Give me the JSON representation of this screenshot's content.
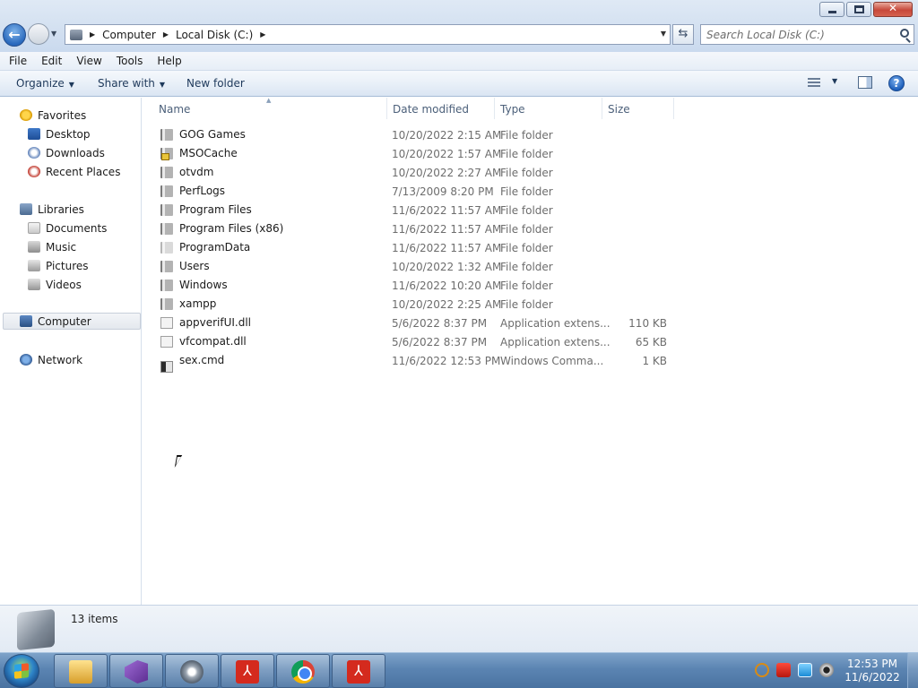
{
  "window": {
    "minimize_label": "",
    "maximize_label": "",
    "close_label": "✕"
  },
  "address_bar": {
    "crumbs": [
      "Computer",
      "Local Disk (C:)"
    ],
    "search_placeholder": "Search Local Disk (C:)"
  },
  "menu": [
    "File",
    "Edit",
    "View",
    "Tools",
    "Help"
  ],
  "toolbar": {
    "organize": "Organize",
    "share_with": "Share with",
    "new_folder": "New folder"
  },
  "nav_pane": {
    "favorites": {
      "label": "Favorites",
      "items": [
        "Desktop",
        "Downloads",
        "Recent Places"
      ]
    },
    "libraries": {
      "label": "Libraries",
      "items": [
        "Documents",
        "Music",
        "Pictures",
        "Videos"
      ]
    },
    "computer": "Computer",
    "network": "Network"
  },
  "columns": [
    "Name",
    "Date modified",
    "Type",
    "Size"
  ],
  "files": [
    {
      "name": "GOG Games",
      "date": "10/20/2022 2:15 AM",
      "type": "File folder",
      "size": "",
      "icon": "folder-icon"
    },
    {
      "name": "MSOCache",
      "date": "10/20/2022 1:57 AM",
      "type": "File folder",
      "size": "",
      "icon": "locked-folder-icon"
    },
    {
      "name": "otvdm",
      "date": "10/20/2022 2:27 AM",
      "type": "File folder",
      "size": "",
      "icon": "folder-icon"
    },
    {
      "name": "PerfLogs",
      "date": "7/13/2009 8:20 PM",
      "type": "File folder",
      "size": "",
      "icon": "folder-icon"
    },
    {
      "name": "Program Files",
      "date": "11/6/2022 11:57 AM",
      "type": "File folder",
      "size": "",
      "icon": "folder-icon"
    },
    {
      "name": "Program Files (x86)",
      "date": "11/6/2022 11:57 AM",
      "type": "File folder",
      "size": "",
      "icon": "folder-icon"
    },
    {
      "name": "ProgramData",
      "date": "11/6/2022 11:57 AM",
      "type": "File folder",
      "size": "",
      "icon": "hidden-folder-icon"
    },
    {
      "name": "Users",
      "date": "10/20/2022 1:32 AM",
      "type": "File folder",
      "size": "",
      "icon": "folder-icon"
    },
    {
      "name": "Windows",
      "date": "11/6/2022 10:20 AM",
      "type": "File folder",
      "size": "",
      "icon": "folder-icon"
    },
    {
      "name": "xampp",
      "date": "10/20/2022 2:25 AM",
      "type": "File folder",
      "size": "",
      "icon": "folder-icon"
    },
    {
      "name": "appverifUI.dll",
      "date": "5/6/2022 8:37 PM",
      "type": "Application extens...",
      "size": "110 KB",
      "icon": "dll-file-icon"
    },
    {
      "name": "vfcompat.dll",
      "date": "5/6/2022 8:37 PM",
      "type": "Application extens...",
      "size": "65 KB",
      "icon": "dll-file-icon"
    },
    {
      "name": "sex.cmd",
      "date": "11/6/2022 12:53 PM",
      "type": "Windows Comma...",
      "size": "1 KB",
      "icon": "cmd-file-icon"
    }
  ],
  "status": {
    "item_count": "13 items"
  },
  "taskbar": {
    "apps": [
      "windows-explorer-icon",
      "visual-studio-icon",
      "media-player-icon",
      "acrobat-icon",
      "chrome-icon",
      "acrobat-icon"
    ],
    "clock_time": "12:53 PM",
    "clock_date": "11/6/2022"
  }
}
